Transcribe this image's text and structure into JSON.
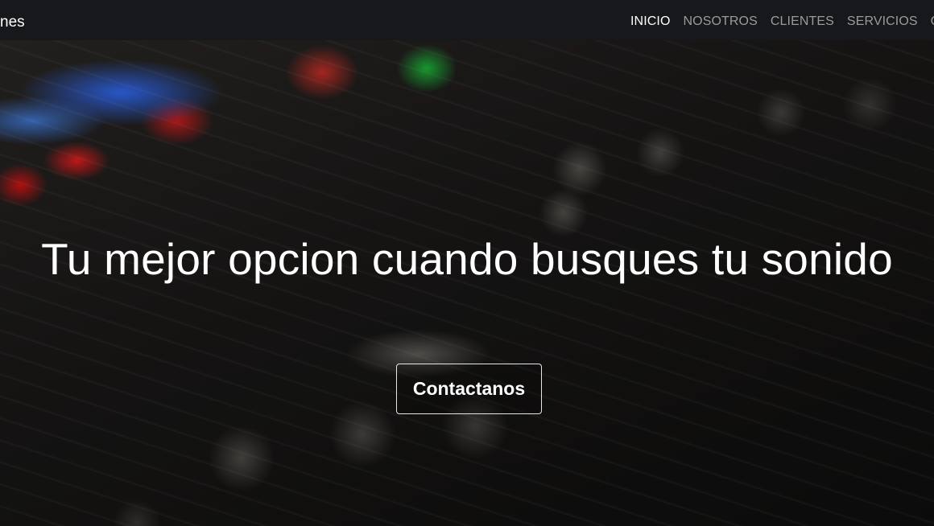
{
  "navbar": {
    "brand": "nes",
    "links": [
      {
        "label": "INICIO",
        "active": true
      },
      {
        "label": "NOSOTROS",
        "active": false
      },
      {
        "label": "CLIENTES",
        "active": false
      },
      {
        "label": "SERVICIOS",
        "active": false
      },
      {
        "label": "C",
        "active": false
      }
    ]
  },
  "hero": {
    "title": "Tu mejor opcion cuando busques tu sonido",
    "cta_label": "Contactanos"
  },
  "colors": {
    "navbar_bg": "#17181b",
    "nav_active": "#ffffff",
    "nav_inactive": "#9a9b9d"
  }
}
